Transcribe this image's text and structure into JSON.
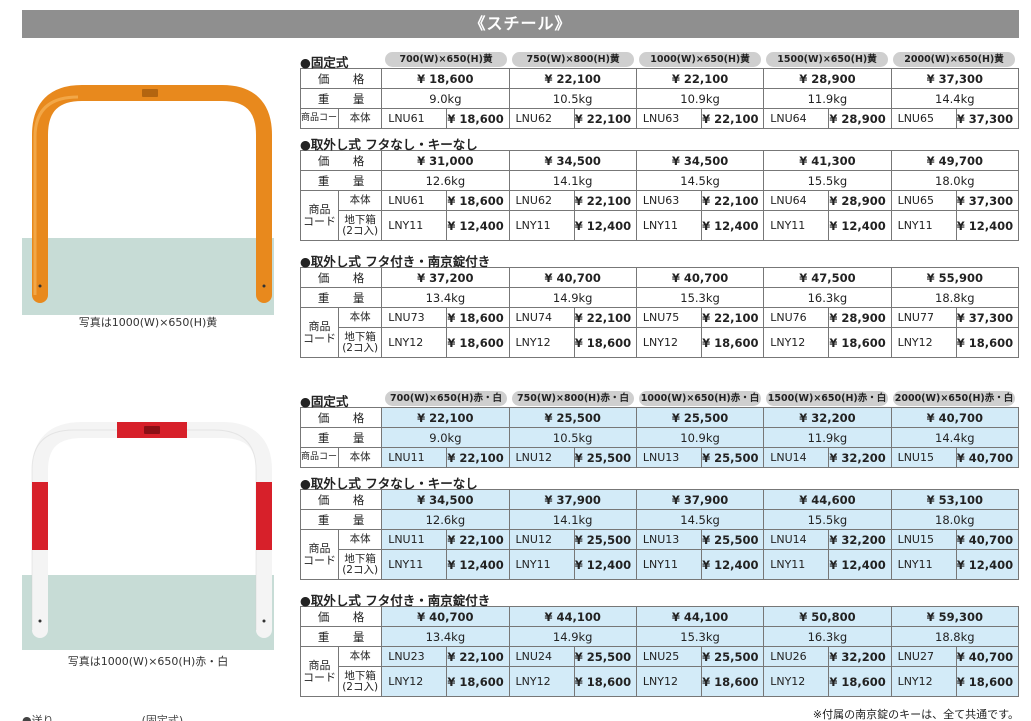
{
  "title": "《スチール》",
  "captions": {
    "yellow": "写真は1000(W)×650(H)黄",
    "redwhite": "写真は1000(W)×650(H)赤・白"
  },
  "labels": {
    "price": "価　格",
    "weight": "重　量",
    "product_code": "商品コード",
    "product_code_2": "商品\nコード",
    "body": "本体",
    "underground_box": "地下箱\n(2コ入)",
    "fixed": "●固定式",
    "removable_no_lid": "●取外し式 フタなし・キーなし",
    "removable_lid": "●取外し式 フタ付き・南京錠付き"
  },
  "yellow": {
    "sizes": [
      "700(W)×650(H)黄",
      "750(W)×800(H)黄",
      "1000(W)×650(H)黄",
      "1500(W)×650(H)黄",
      "2000(W)×650(H)黄"
    ],
    "fixed": {
      "price": [
        "¥ 18,600",
        "¥ 22,100",
        "¥ 22,100",
        "¥ 28,900",
        "¥ 37,300"
      ],
      "weight": [
        "9.0kg",
        "10.5kg",
        "10.9kg",
        "11.9kg",
        "14.4kg"
      ],
      "body": [
        [
          "LNU61",
          "¥ 18,600"
        ],
        [
          "LNU62",
          "¥ 22,100"
        ],
        [
          "LNU63",
          "¥ 22,100"
        ],
        [
          "LNU64",
          "¥ 28,900"
        ],
        [
          "LNU65",
          "¥ 37,300"
        ]
      ]
    },
    "nolid": {
      "price": [
        "¥ 31,000",
        "¥ 34,500",
        "¥ 34,500",
        "¥ 41,300",
        "¥ 49,700"
      ],
      "weight": [
        "12.6kg",
        "14.1kg",
        "14.5kg",
        "15.5kg",
        "18.0kg"
      ],
      "body": [
        [
          "LNU61",
          "¥ 18,600"
        ],
        [
          "LNU62",
          "¥ 22,100"
        ],
        [
          "LNU63",
          "¥ 22,100"
        ],
        [
          "LNU64",
          "¥ 28,900"
        ],
        [
          "LNU65",
          "¥ 37,300"
        ]
      ],
      "box": [
        [
          "LNY11",
          "¥ 12,400"
        ],
        [
          "LNY11",
          "¥ 12,400"
        ],
        [
          "LNY11",
          "¥ 12,400"
        ],
        [
          "LNY11",
          "¥ 12,400"
        ],
        [
          "LNY11",
          "¥ 12,400"
        ]
      ]
    },
    "lid": {
      "price": [
        "¥ 37,200",
        "¥ 40,700",
        "¥ 40,700",
        "¥ 47,500",
        "¥ 55,900"
      ],
      "weight": [
        "13.4kg",
        "14.9kg",
        "15.3kg",
        "16.3kg",
        "18.8kg"
      ],
      "body": [
        [
          "LNU73",
          "¥ 18,600"
        ],
        [
          "LNU74",
          "¥ 22,100"
        ],
        [
          "LNU75",
          "¥ 22,100"
        ],
        [
          "LNU76",
          "¥ 28,900"
        ],
        [
          "LNU77",
          "¥ 37,300"
        ]
      ],
      "box": [
        [
          "LNY12",
          "¥ 18,600"
        ],
        [
          "LNY12",
          "¥ 18,600"
        ],
        [
          "LNY12",
          "¥ 18,600"
        ],
        [
          "LNY12",
          "¥ 18,600"
        ],
        [
          "LNY12",
          "¥ 18,600"
        ]
      ]
    }
  },
  "redwhite": {
    "sizes": [
      "700(W)×650(H)赤・白",
      "750(W)×800(H)赤・白",
      "1000(W)×650(H)赤・白",
      "1500(W)×650(H)赤・白",
      "2000(W)×650(H)赤・白"
    ],
    "fixed": {
      "price": [
        "¥ 22,100",
        "¥ 25,500",
        "¥ 25,500",
        "¥ 32,200",
        "¥ 40,700"
      ],
      "weight": [
        "9.0kg",
        "10.5kg",
        "10.9kg",
        "11.9kg",
        "14.4kg"
      ],
      "body": [
        [
          "LNU11",
          "¥ 22,100"
        ],
        [
          "LNU12",
          "¥ 25,500"
        ],
        [
          "LNU13",
          "¥ 25,500"
        ],
        [
          "LNU14",
          "¥ 32,200"
        ],
        [
          "LNU15",
          "¥ 40,700"
        ]
      ]
    },
    "nolid": {
      "price": [
        "¥ 34,500",
        "¥ 37,900",
        "¥ 37,900",
        "¥ 44,600",
        "¥ 53,100"
      ],
      "weight": [
        "12.6kg",
        "14.1kg",
        "14.5kg",
        "15.5kg",
        "18.0kg"
      ],
      "body": [
        [
          "LNU11",
          "¥ 22,100"
        ],
        [
          "LNU12",
          "¥ 25,500"
        ],
        [
          "LNU13",
          "¥ 25,500"
        ],
        [
          "LNU14",
          "¥ 32,200"
        ],
        [
          "LNU15",
          "¥ 40,700"
        ]
      ],
      "box": [
        [
          "LNY11",
          "¥ 12,400"
        ],
        [
          "LNY11",
          "¥ 12,400"
        ],
        [
          "LNY11",
          "¥ 12,400"
        ],
        [
          "LNY11",
          "¥ 12,400"
        ],
        [
          "LNY11",
          "¥ 12,400"
        ]
      ]
    },
    "lid": {
      "price": [
        "¥ 40,700",
        "¥ 44,100",
        "¥ 44,100",
        "¥ 50,800",
        "¥ 59,300"
      ],
      "weight": [
        "13.4kg",
        "14.9kg",
        "15.3kg",
        "16.3kg",
        "18.8kg"
      ],
      "body": [
        [
          "LNU23",
          "¥ 22,100"
        ],
        [
          "LNU24",
          "¥ 25,500"
        ],
        [
          "LNU25",
          "¥ 25,500"
        ],
        [
          "LNU26",
          "¥ 32,200"
        ],
        [
          "LNU27",
          "¥ 40,700"
        ]
      ],
      "box": [
        [
          "LNY12",
          "¥ 18,600"
        ],
        [
          "LNY12",
          "¥ 18,600"
        ],
        [
          "LNY12",
          "¥ 18,600"
        ],
        [
          "LNY12",
          "¥ 18,600"
        ],
        [
          "LNY12",
          "¥ 18,600"
        ]
      ]
    }
  },
  "footnote": "※付属の南京錠のキーは、全て共通です。",
  "bottom_cut_text": "●送り　　　　　　　　(固定式)",
  "colors": {
    "header_bar": "#8f8f8f",
    "yellow_bar": "#e8891d",
    "red": "#d7202a",
    "ground": "#c7dcd6",
    "blue_cell": "#d3ebf8"
  }
}
